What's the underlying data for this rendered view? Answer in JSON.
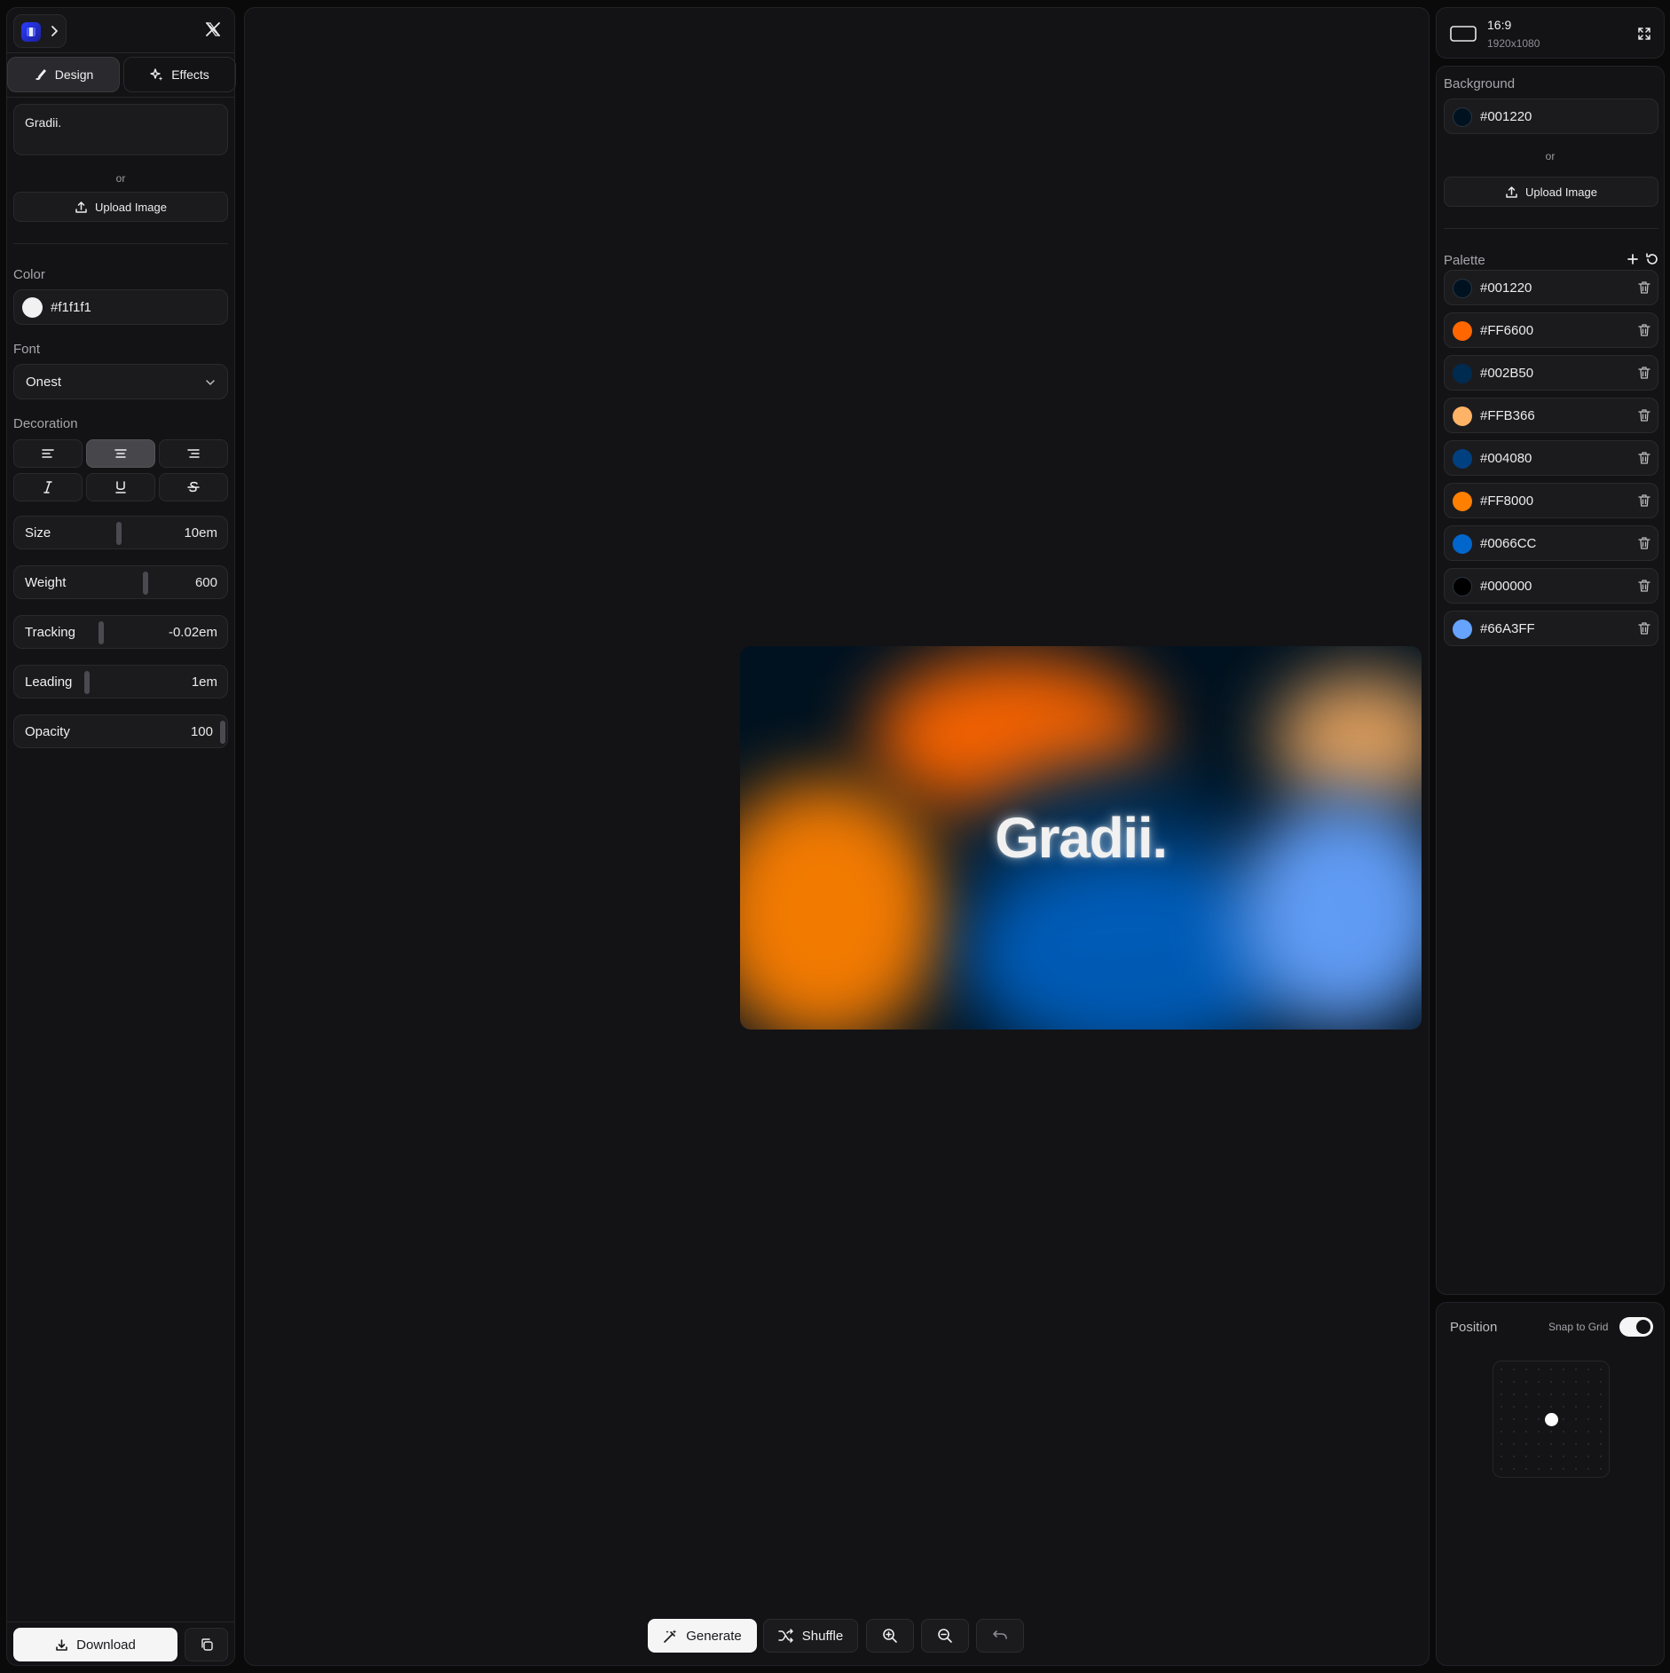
{
  "left": {
    "logo_name": "app-logo",
    "text_input": "Gradii.",
    "or_text": "or",
    "upload_label": "Upload Image",
    "tabs": [
      {
        "label": "Design"
      },
      {
        "label": "Effects"
      }
    ],
    "color_label": "Color",
    "color_value": "#f1f1f1",
    "font_label": "Font",
    "font_value": "Onest",
    "decoration_label": "Decoration",
    "sliders": [
      {
        "label": "Size",
        "value": "10em",
        "level": 0.49
      },
      {
        "label": "Weight",
        "value": "600",
        "level": 0.62
      },
      {
        "label": "Tracking",
        "value": "-0.02em",
        "level": 0.4
      },
      {
        "label": "Leading",
        "value": "1em",
        "level": 0.33
      },
      {
        "label": "Opacity",
        "value": "100",
        "level": 1.0
      }
    ],
    "download_label": "Download"
  },
  "canvas": {
    "preview_text": "Gradii.",
    "toolbar": {
      "generate": "Generate",
      "shuffle": "Shuffle"
    }
  },
  "right": {
    "ratio": "16:9",
    "resolution": "1920x1080",
    "background_label": "Background",
    "background_value": "#001220",
    "or_text": "or",
    "upload_label": "Upload Image",
    "palette_label": "Palette",
    "palette": [
      "#001220",
      "#FF6600",
      "#002B50",
      "#FFB366",
      "#004080",
      "#FF8000",
      "#0066CC",
      "#000000",
      "#66A3FF"
    ],
    "position_label": "Position",
    "snap_label": "Snap to Grid",
    "snap_on": true
  },
  "colors": {
    "text_color": "#f1f1f1",
    "background": "#001220"
  }
}
